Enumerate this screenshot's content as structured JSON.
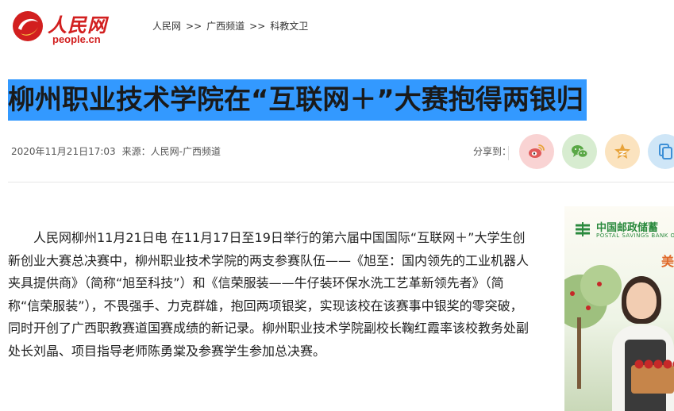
{
  "header": {
    "logo_cn": "人民网",
    "logo_en": "people.cn",
    "breadcrumb": [
      {
        "label": "人民网"
      },
      {
        "label": "广西频道"
      },
      {
        "label": "科教文卫"
      }
    ],
    "breadcrumb_sep": ">>"
  },
  "article": {
    "title": "柳州职业技术学院在“互联网＋”大赛抱得两银归",
    "datetime": "2020年11月21日17:03",
    "source": "来源：人民网-广西频道",
    "body": "人民网柳州11月21日电 在11月17日至19日举行的第六届中国国际“互联网＋”大学生创新创业大赛总决赛中，柳州职业技术学院的两支参赛队伍——《旭至：国内领先的工业机器人夹具提供商》（简称“旭至科技”）和《信荣服装——牛仔装环保水洗工艺革新领先者》（简称“信荣服装”），不畏强手、力克群雄，抱回两项银奖，实现该校在该赛事中银奖的零突破，同时开创了广西职教赛道国赛成绩的新记录。柳州职业技术学院副校长鞠红霞率该校教务处副处长刘晶、项目指导老师陈勇棠及参赛学生参加总决赛。"
  },
  "share": {
    "label": "分享到：",
    "buttons": [
      {
        "icon": "weibo-icon",
        "color": "#e05a5a"
      },
      {
        "icon": "wechat-icon",
        "color": "#5aa846"
      },
      {
        "icon": "qzone-icon",
        "color": "#e8a33a"
      },
      {
        "icon": "copy-link-icon",
        "color": "#3d8fd6"
      }
    ]
  },
  "ad": {
    "brand_cn": "中国邮政储蓄",
    "brand_en": "POSTAL SAVINGS BANK OF",
    "slogan": "美"
  },
  "colors": {
    "brand_red": "#d21f1f",
    "title_highlight": "#3399ff"
  }
}
